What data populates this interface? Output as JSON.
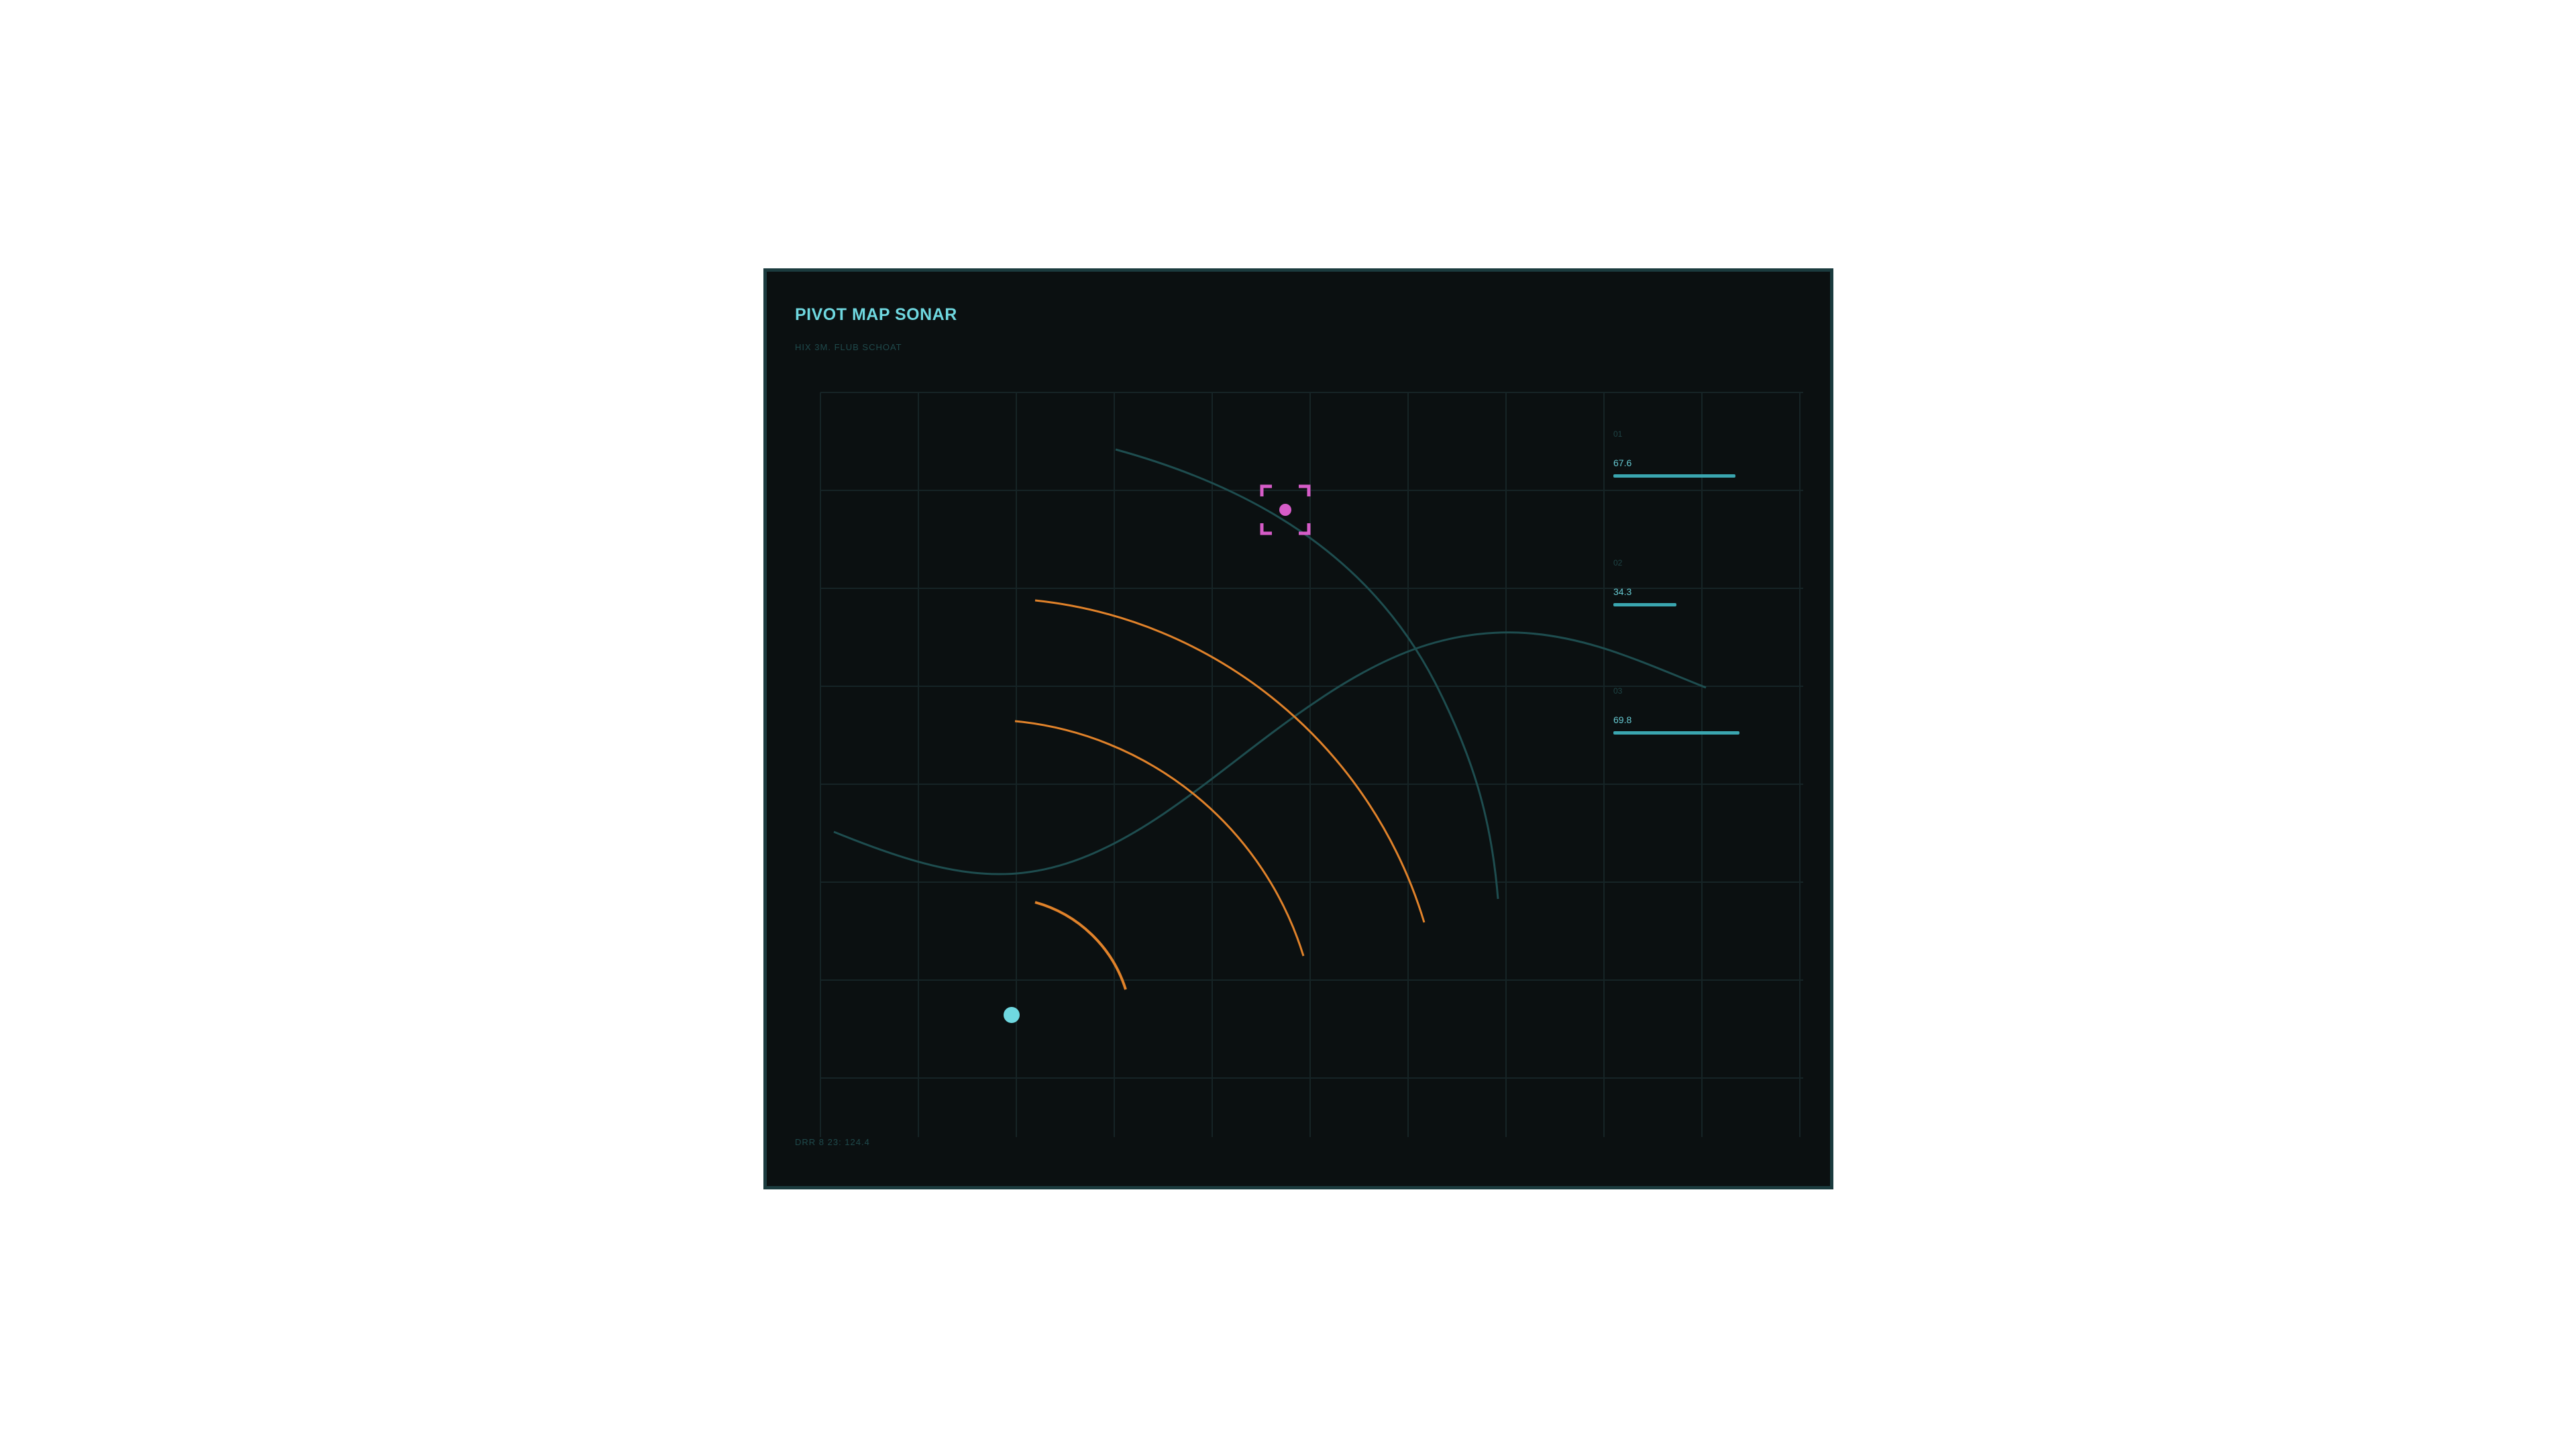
{
  "hud": {
    "title": "PIVOT MAP SONAR",
    "subtitle": "HIX 3M. FLUB SCHOAT",
    "footer_code": "DRR 8 23: 124.4"
  },
  "meters": [
    {
      "label": "01",
      "value_text": "67.6",
      "fill_fraction": 0.91
    },
    {
      "label": "02",
      "value_text": "34.3",
      "fill_fraction": 0.47
    },
    {
      "label": "03",
      "value_text": "69.8",
      "fill_fraction": 0.94
    }
  ],
  "colors": {
    "accent": "#6fd8e0",
    "target": "#d65cc8",
    "sonar_ring": "#e0822a",
    "contour": "#1e4d4f",
    "grid": "#162426",
    "player": "#6fd8e0"
  },
  "icons": {
    "player": "player-dot-icon",
    "target": "target-reticle-icon"
  }
}
